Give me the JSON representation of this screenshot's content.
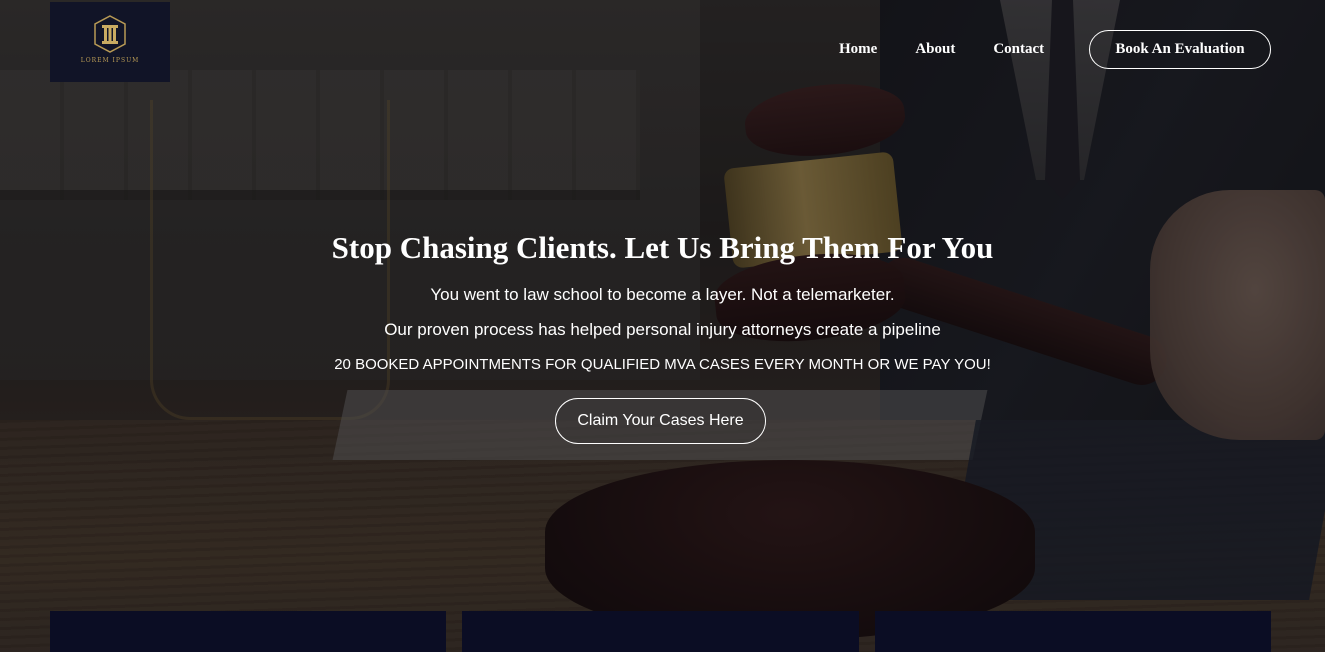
{
  "logo": {
    "name": "LOREM IPSUM",
    "icon": "pillar-icon"
  },
  "nav": {
    "items": [
      {
        "label": "Home"
      },
      {
        "label": "About"
      },
      {
        "label": "Contact"
      }
    ],
    "cta_label": "Book An Evaluation"
  },
  "hero": {
    "background": "courtroom-gavel-photo",
    "title": "Stop Chasing Clients. Let Us Bring Them For You",
    "line1": "You went to law school to become a layer. Not a telemarketer.",
    "line2": "Our proven process has helped personal injury attorneys create a pipeline",
    "line3": "20 BOOKED APPOINTMENTS FOR QUALIFIED MVA CASES EVERY MONTH OR WE PAY YOU!",
    "cta_label": "Claim Your Cases Here"
  },
  "colors": {
    "logo_bg": "#111427",
    "card_bg": "#0b0d24",
    "text": "#ffffff",
    "logo_gold": "#b89a55"
  }
}
